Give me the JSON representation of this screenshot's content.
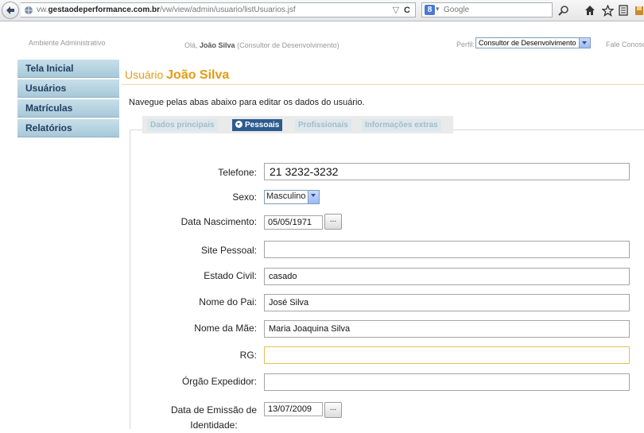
{
  "browser": {
    "url_prefix": "vw.",
    "url_domain": "gestaodeperformance.com.br",
    "url_path": "/vw/view/admin/usuario/listUsuarios.jsf",
    "search_placeholder": "Google"
  },
  "header": {
    "environment": "Ambiente Administrativo",
    "greeting_prefix": "Olá,",
    "user_name": "João Silva",
    "user_role": "(Consultor de Desenvolvimento)",
    "perfil_label": "Perfil:",
    "perfil_value": "Consultor de Desenvolvimento",
    "contact": "Fale Conosco"
  },
  "sidebar": {
    "items": [
      {
        "label": "Tela Inicial"
      },
      {
        "label": "Usuários"
      },
      {
        "label": "Matrículas"
      },
      {
        "label": "Relatórios"
      }
    ]
  },
  "main": {
    "title_prefix": "Usuário",
    "title_name": "João Silva",
    "intro": "Navegue pelas abas abaixo para editar os dados do usuário.",
    "tabs": [
      {
        "label": "Dados principais"
      },
      {
        "label": "Pessoais"
      },
      {
        "label": "Profissionais"
      },
      {
        "label": "Informações extras"
      }
    ],
    "active_tab": "Pessoais"
  },
  "form": {
    "telefone": {
      "label": "Telefone:",
      "value": "21 3232-3232"
    },
    "sexo": {
      "label": "Sexo:",
      "value": "Masculino"
    },
    "nascimento": {
      "label": "Data Nascimento:",
      "value": "05/05/1971",
      "button": "..."
    },
    "site": {
      "label": "Site Pessoal:",
      "value": ""
    },
    "estado_civil": {
      "label": "Estado Civil:",
      "value": "casado"
    },
    "pai": {
      "label": "Nome do Pai:",
      "value": "José Silva"
    },
    "mae": {
      "label": "Nome da Mãe:",
      "value": "Maria Joaquina Silva"
    },
    "rg": {
      "label": "RG:",
      "value": ""
    },
    "orgao": {
      "label": "Órgão Expedidor:",
      "value": ""
    },
    "emissao": {
      "label_line1": "Data de Emissão de",
      "label_line2": "Identidade:",
      "value": "13/07/2009",
      "button": "..."
    }
  }
}
